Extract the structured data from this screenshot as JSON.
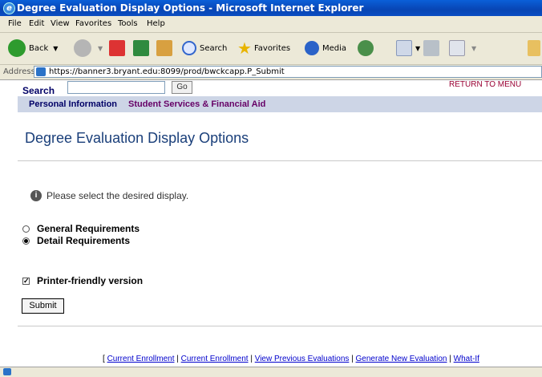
{
  "window": {
    "title": "Degree Evaluation Display Options - Microsoft Internet Explorer"
  },
  "menu": [
    "File",
    "Edit",
    "View",
    "Favorites",
    "Tools",
    "Help"
  ],
  "toolbar": {
    "back": "Back",
    "search": "Search",
    "favorites": "Favorites",
    "media": "Media"
  },
  "address": {
    "label": "Address",
    "url": "https://banner3.bryant.edu:8099/prod/bwckcapp.P_Submit"
  },
  "page": {
    "search_label": "Search",
    "go_label": "Go",
    "return_menu": "RETURN TO MENU",
    "nav": [
      "Personal Information",
      "Student Services & Financial Aid"
    ],
    "title": "Degree Evaluation Display Options",
    "info_text": "Please select the desired display.",
    "options": [
      {
        "label": "General Requirements",
        "selected": false
      },
      {
        "label": "Detail Requirements",
        "selected": true
      }
    ],
    "printer_friendly": {
      "label": "Printer-friendly version",
      "checked": true
    },
    "submit_label": "Submit",
    "footer_links": [
      "Current Enrollment",
      "Current Enrollment",
      "View Previous Evaluations",
      "Generate New Evaluation",
      "What-If"
    ]
  },
  "colors": {
    "title_blue": "#1a3f7a",
    "nav_bg": "#cdd5e6",
    "link": "#0000cc",
    "return": "#990033"
  }
}
